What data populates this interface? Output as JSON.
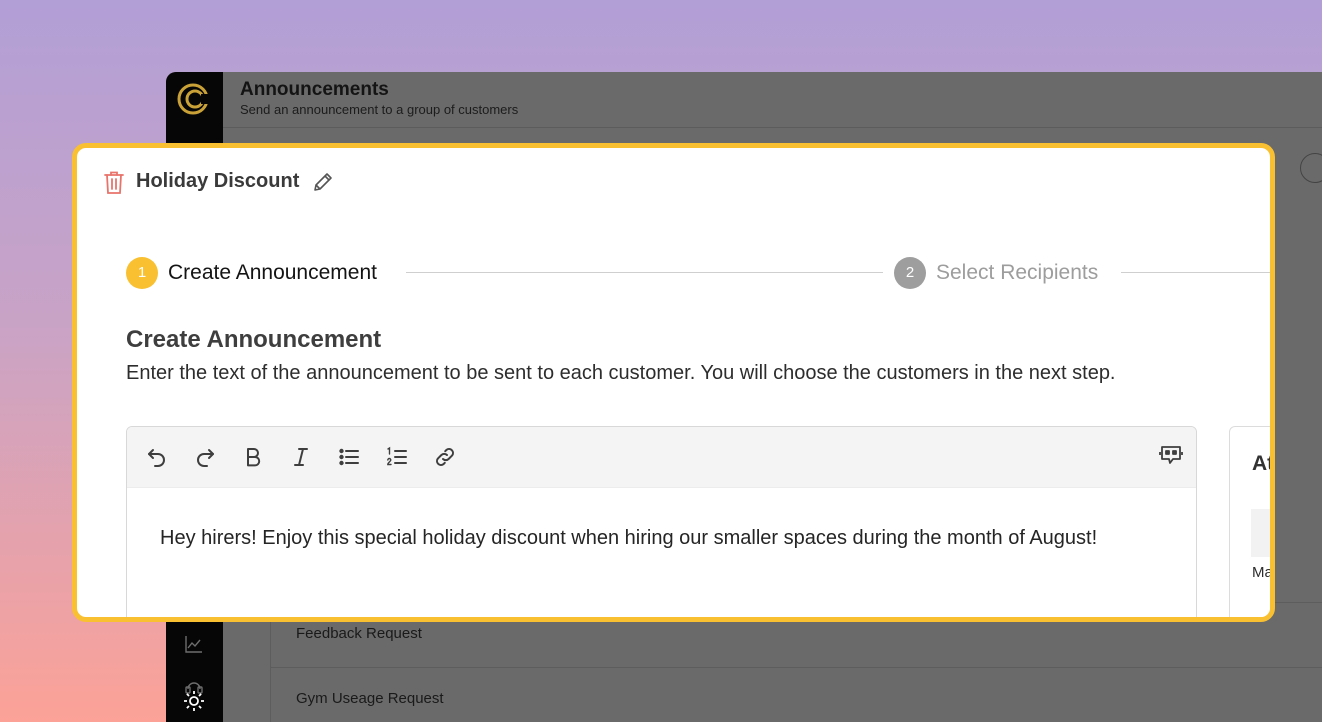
{
  "app": {
    "title": "Announcements",
    "subtitle": "Send an announcement to a group of customers",
    "list_rows": [
      "Feedback Request",
      "Gym Useage Request"
    ]
  },
  "modal": {
    "title": "Holiday Discount",
    "steps": [
      {
        "number": "1",
        "label": "Create Announcement",
        "state": "active"
      },
      {
        "number": "2",
        "label": "Select Recipients",
        "state": "inactive"
      }
    ],
    "section_title": "Create Announcement",
    "section_description": "Enter the text of the announcement to be sent to each customer. You will choose the customers in the next step.",
    "editor": {
      "toolbar": [
        "undo-icon",
        "redo-icon",
        "bold-icon",
        "italic-icon",
        "bullet-list-icon",
        "numbered-list-icon",
        "link-icon",
        "ai-chat-icon"
      ],
      "content": "Hey hirers! Enjoy this special holiday discount when hiring our smaller spaces during the month of August!"
    },
    "side_panel": {
      "title": "At",
      "label": "Ma"
    }
  },
  "colors": {
    "accent": "#f9c031",
    "trash": "#e8736b",
    "step_inactive": "#9e9e9e"
  }
}
